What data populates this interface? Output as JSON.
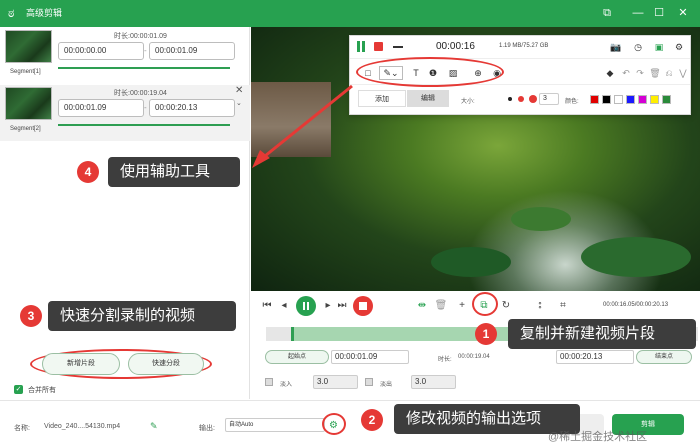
{
  "window": {
    "logo_glyph": "ಠ",
    "title": "高级剪辑",
    "buttons": {
      "restore": "⧉",
      "minimize": "—",
      "maximize": "☐",
      "close": "✕"
    }
  },
  "segments": [
    {
      "label": "Segment[1]",
      "duration_label": "时长:",
      "duration": "00:00:01.09",
      "start": "00:00:00.00",
      "end": "00:00:01.09",
      "separator": "-"
    },
    {
      "label": "Segment[2]",
      "duration_label": "时长:",
      "duration": "00:00:19.04",
      "start": "00:00:01.09",
      "end": "00:00:20.13",
      "separator": "-"
    }
  ],
  "left_actions": {
    "new_segment": "新增片段",
    "quick_split": "快速分段",
    "merge_all": "合并所有"
  },
  "float_toolbar": {
    "time": "00:00:16",
    "size": "1.19 MB/75.27 GB",
    "tab_add": "添加",
    "tab_edit": "编辑",
    "size_label": "大小:",
    "size_value": "3",
    "color_label": "颜色:",
    "colors": [
      "#e00000",
      "#000000",
      "#ffffff",
      "#1a1aff",
      "#d400d4",
      "#ffee00",
      "#2a8a3a"
    ]
  },
  "playback": {
    "time_readout": "00:00:16.05/00:00:20.13"
  },
  "trim": {
    "start_button": "起始点",
    "start_value": "00:00:01.09",
    "duration_label": "时长:",
    "duration_value": "00:00:19.04",
    "end_value": "00:00:20.13",
    "end_button": "结束点",
    "fade_in_label": "淡入",
    "fade_in_value": "3.0",
    "fade_out_label": "淡出",
    "fade_out_value": "3.0"
  },
  "bottom": {
    "name_label": "名称:",
    "name_value": "Video_240....54130.mp4",
    "output_label": "输出:",
    "output_value": "自动Auto",
    "edit_button": "剪辑"
  },
  "annotations": [
    {
      "number": "1",
      "text": "复制并新建视频片段"
    },
    {
      "number": "2",
      "text": "修改视频的输出选项"
    },
    {
      "number": "3",
      "text": "快速分割录制的视频"
    },
    {
      "number": "4",
      "text": "使用辅助工具"
    }
  ],
  "watermark": "@稀土掘金技术社区"
}
